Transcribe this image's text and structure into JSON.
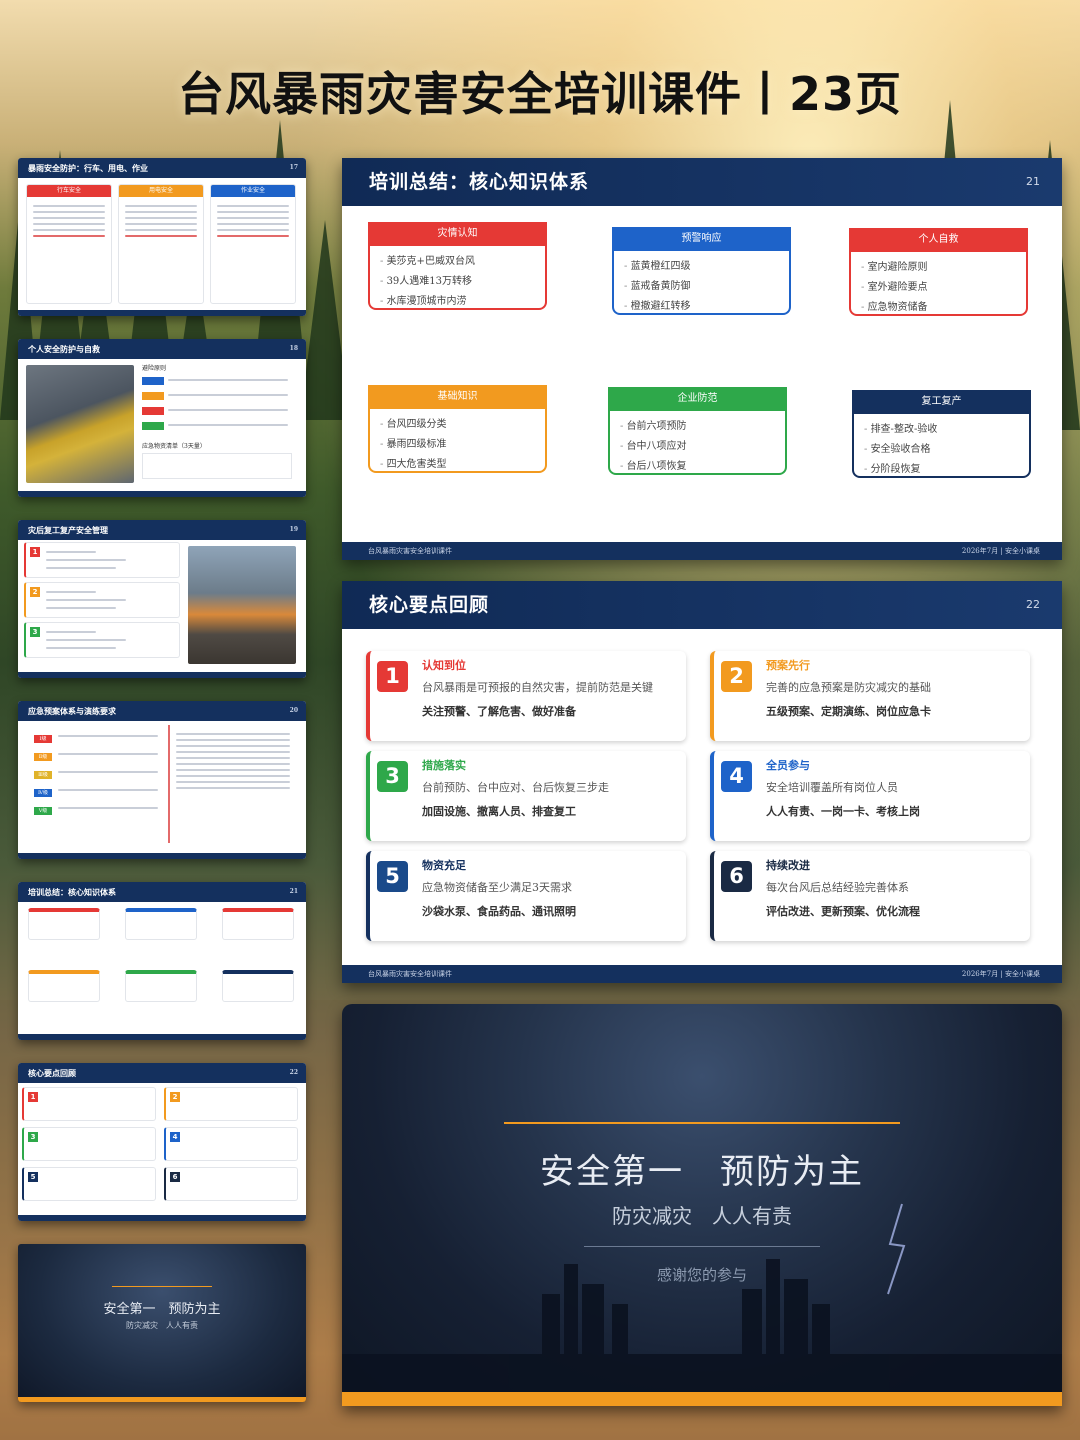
{
  "page": {
    "title": "台风暴雨灾害安全培训课件丨23页"
  },
  "thumbnails": {
    "t1": {
      "title": "暴雨安全防护：行车、用电、作业",
      "cols": [
        "行车安全",
        "用电安全",
        "作业安全"
      ]
    },
    "t2": {
      "title": "个人安全防护与自救",
      "sub1": "避险原则",
      "sub2": "应急物资清单（3天量）"
    },
    "t3": {
      "title": "灾后复工复产安全管理"
    },
    "t4": {
      "title": "应急预案体系与演练要求",
      "levels": [
        "Ⅰ级",
        "Ⅱ级",
        "Ⅲ级",
        "Ⅳ级",
        "Ⅴ级"
      ]
    },
    "t5": {
      "title": "培训总结：核心知识体系"
    },
    "t6": {
      "title": "核心要点回顾"
    },
    "t7": {
      "line1": "安全第一　预防为主",
      "line2": "防灾减灾　人人有责"
    }
  },
  "summary_slide": {
    "title": "培训总结：核心知识体系",
    "page_num": "21",
    "footer_left": "台风暴雨灾害安全培训课件",
    "footer_right": "2026年7月 | 安全小课桌",
    "cards": [
      {
        "head": "灾情认知",
        "items": [
          "美莎克+巴威双台风",
          "39人遇难13万转移",
          "水库漫顶城市内涝"
        ]
      },
      {
        "head": "预警响应",
        "items": [
          "蓝黄橙红四级",
          "蓝戒备黄防御",
          "橙撤避红转移"
        ]
      },
      {
        "head": "个人自救",
        "items": [
          "室内避险原则",
          "室外避险要点",
          "应急物资储备"
        ]
      },
      {
        "head": "基础知识",
        "items": [
          "台风四级分类",
          "暴雨四级标准",
          "四大危害类型"
        ]
      },
      {
        "head": "企业防范",
        "items": [
          "台前六项预防",
          "台中八项应对",
          "台后八项恢复"
        ]
      },
      {
        "head": "复工复产",
        "items": [
          "排查-整改-验收",
          "安全验收合格",
          "分阶段恢复"
        ]
      }
    ]
  },
  "review_slide": {
    "title": "核心要点回顾",
    "page_num": "22",
    "footer_left": "台风暴雨灾害安全培训课件",
    "footer_right": "2026年7月 | 安全小课桌",
    "items": [
      {
        "num": "1",
        "title": "认知到位",
        "desc": "台风暴雨是可预报的自然灾害，提前防范是关键",
        "key": "关注预警、了解危害、做好准备"
      },
      {
        "num": "2",
        "title": "预案先行",
        "desc": "完善的应急预案是防灾减灾的基础",
        "key": "五级预案、定期演练、岗位应急卡"
      },
      {
        "num": "3",
        "title": "措施落实",
        "desc": "台前预防、台中应对、台后恢复三步走",
        "key": "加固设施、撤离人员、排查复工"
      },
      {
        "num": "4",
        "title": "全员参与",
        "desc": "安全培训覆盖所有岗位人员",
        "key": "人人有责、一岗一卡、考核上岗"
      },
      {
        "num": "5",
        "title": "物资充足",
        "desc": "应急物资储备至少满足3天需求",
        "key": "沙袋水泵、食品药品、通讯照明"
      },
      {
        "num": "6",
        "title": "持续改进",
        "desc": "每次台风后总结经验完善体系",
        "key": "评估改进、更新预案、优化流程"
      }
    ]
  },
  "closing_slide": {
    "line1": "安全第一　预防为主",
    "line2": "防灾减灾　人人有责",
    "line3": "感谢您的参与"
  },
  "colors": {
    "navy": "#14305e",
    "red": "#e53935",
    "blue": "#1e63c9",
    "orange": "#f29a1f",
    "green": "#2ea84a"
  }
}
